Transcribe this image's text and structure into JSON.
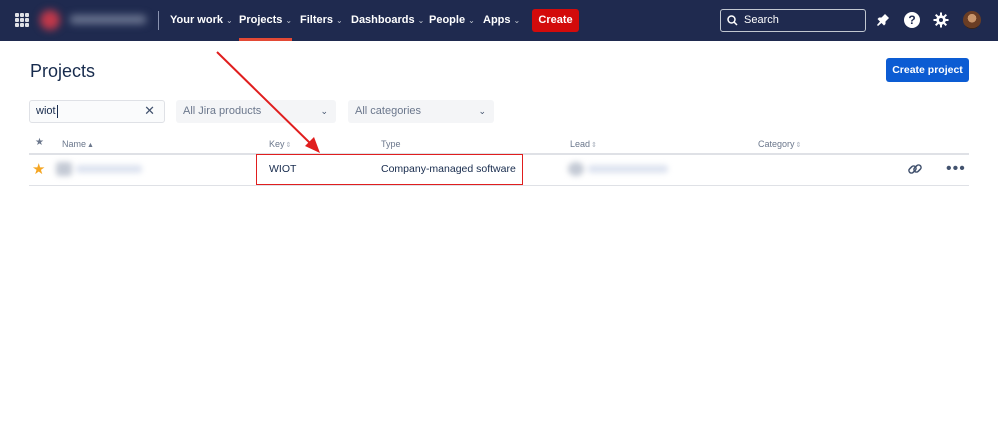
{
  "nav": {
    "your_work": "Your work",
    "projects": "Projects",
    "filters": "Filters",
    "dashboards": "Dashboards",
    "people": "People",
    "apps": "Apps",
    "create": "Create",
    "search_placeholder": "Search",
    "icons": [
      "apps-grid-icon",
      "notifications-icon",
      "help-icon",
      "settings-icon"
    ]
  },
  "page": {
    "title": "Projects",
    "create_project": "Create project"
  },
  "filters": {
    "search_value": "wiot",
    "products": "All Jira products",
    "categories": "All categories"
  },
  "table": {
    "columns": [
      "Name",
      "Key",
      "Type",
      "Lead",
      "Category"
    ],
    "rows": [
      {
        "starred": true,
        "key": "WIOT",
        "type": "Company-managed software"
      }
    ]
  },
  "colors": {
    "topbar": "#1f2a4f",
    "create": "#d30b0b",
    "primary": "#0c5cd3",
    "annotation": "#e01e1e",
    "star": "#f5a623"
  }
}
